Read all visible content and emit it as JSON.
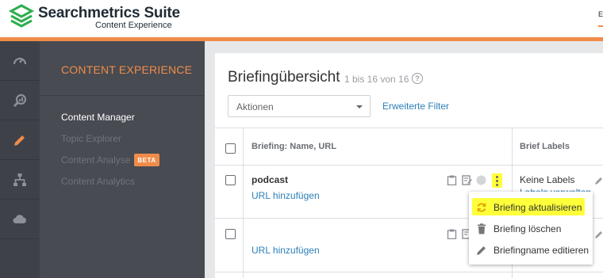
{
  "app": {
    "brand": "Searchmetrics Suite",
    "sub_brand": "Content Experience",
    "top_right_char": "E",
    "accent_color": "#f08c4a",
    "link_color": "#2c7fb8",
    "highlight_color": "#ffff3a"
  },
  "rail": {
    "items": [
      {
        "icon": "dashboard-gauge-icon"
      },
      {
        "icon": "research-magnifier-icon"
      },
      {
        "icon": "pencil-icon",
        "active": true
      },
      {
        "icon": "site-structure-icon"
      },
      {
        "icon": "cloud-icon"
      }
    ]
  },
  "subnav": {
    "title": "CONTENT EXPERIENCE",
    "items": [
      {
        "label": "Content Manager",
        "active": true
      },
      {
        "label": "Topic Explorer"
      },
      {
        "label": "Content Analyse",
        "badge": "BETA"
      },
      {
        "label": "Content Analytics"
      }
    ]
  },
  "main": {
    "title": "Briefingübersicht",
    "count": "1 bis 16 von 16",
    "help": "?",
    "actions_select": "Aktionen",
    "advanced_filter": "Erweiterte Filter",
    "columns": [
      "Briefing: Name, URL",
      "Brief Labels"
    ],
    "rows": [
      {
        "name": "podcast",
        "url_link": "URL hinzufügen",
        "labels": "Keine Labels",
        "labels_link": "Labels verwalten"
      },
      {
        "name": "",
        "url_link": "URL hinzufügen"
      }
    ]
  },
  "menu": {
    "items": [
      {
        "label": "Briefing aktualisieren",
        "icon": "refresh-icon",
        "highlighted": true
      },
      {
        "label": "Briefing löschen",
        "icon": "trash-icon"
      },
      {
        "label": "Briefingname editieren",
        "icon": "pencil-icon"
      }
    ]
  }
}
